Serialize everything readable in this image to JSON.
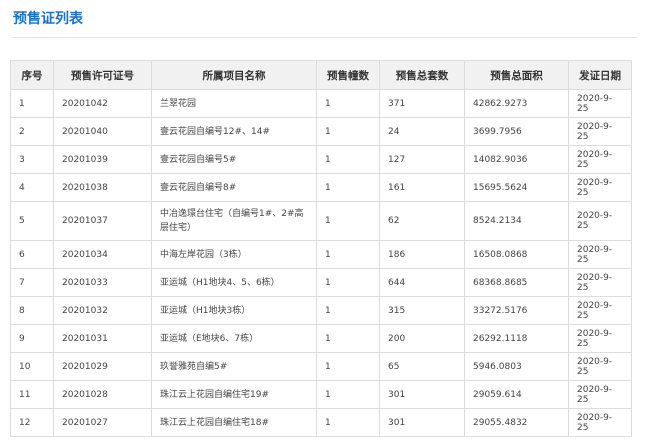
{
  "page": {
    "title": "预售证列表"
  },
  "table": {
    "headers": [
      "序号",
      "预售许可证号",
      "所属项目名称",
      "预售幢数",
      "预售总套数",
      "预售总面积",
      "发证日期"
    ],
    "rows": [
      [
        "1",
        "20201042",
        "兰翠花园",
        "1",
        "371",
        "42862.9273",
        "2020-9-25"
      ],
      [
        "2",
        "20201040",
        "壹云花园自编号12#、14#",
        "1",
        "24",
        "3699.7956",
        "2020-9-25"
      ],
      [
        "3",
        "20201039",
        "壹云花园自编号5#",
        "1",
        "127",
        "14082.9036",
        "2020-9-25"
      ],
      [
        "4",
        "20201038",
        "壹云花园自编号8#",
        "1",
        "161",
        "15695.5624",
        "2020-9-25"
      ],
      [
        "5",
        "20201037",
        "中冶逸璟台住宅（自编号1#、2#高层住宅）",
        "1",
        "62",
        "8524.2134",
        "2020-9-25"
      ],
      [
        "6",
        "20201034",
        "中海左岸花园（3栋）",
        "1",
        "186",
        "16508.0868",
        "2020-9-25"
      ],
      [
        "7",
        "20201033",
        "亚运城（H1地块4、5、6栋）",
        "1",
        "644",
        "68368.8685",
        "2020-9-25"
      ],
      [
        "8",
        "20201032",
        "亚运城（H1地块3栋）",
        "1",
        "315",
        "33272.5176",
        "2020-9-25"
      ],
      [
        "9",
        "20201031",
        "亚运城（E地块6、7栋）",
        "1",
        "200",
        "26292.1118",
        "2020-9-25"
      ],
      [
        "10",
        "20201029",
        "玖誉雅苑自编5#",
        "1",
        "65",
        "5946.0803",
        "2020-9-25"
      ],
      [
        "11",
        "20201028",
        "珠江云上花园自编住宅19#",
        "1",
        "301",
        "29059.614",
        "2020-9-25"
      ],
      [
        "12",
        "20201027",
        "珠江云上花园自编住宅18#",
        "1",
        "301",
        "29055.4832",
        "2020-9-25"
      ]
    ]
  }
}
